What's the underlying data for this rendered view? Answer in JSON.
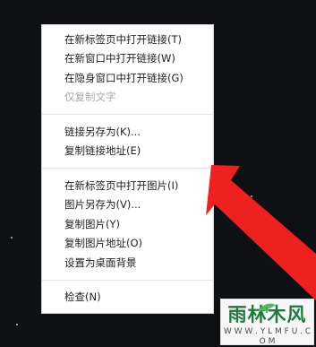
{
  "context_menu": {
    "groups": [
      {
        "items": [
          {
            "label": "在新标签页中打开链接(T)",
            "enabled": true
          },
          {
            "label": "在新窗口中打开链接(W)",
            "enabled": true
          },
          {
            "label": "在隐身窗口中打开链接(G)",
            "enabled": true
          },
          {
            "label": "仅复制文字",
            "enabled": false
          }
        ]
      },
      {
        "items": [
          {
            "label": "链接另存为(K)...",
            "enabled": true
          },
          {
            "label": "复制链接地址(E)",
            "enabled": true
          }
        ]
      },
      {
        "items": [
          {
            "label": "在新标签页中打开图片(I)",
            "enabled": true
          },
          {
            "label": "图片另存为(V)...",
            "enabled": true
          },
          {
            "label": "复制图片(Y)",
            "enabled": true
          },
          {
            "label": "复制图片地址(O)",
            "enabled": true
          },
          {
            "label": "设置为桌面背景",
            "enabled": true
          }
        ]
      },
      {
        "items": [
          {
            "label": "检查(N)",
            "enabled": true
          }
        ]
      }
    ]
  },
  "watermark": {
    "title": "雨林木风",
    "url": "W W W . Y L M F U . C O M"
  },
  "colors": {
    "background": "#0f1013",
    "menu_background": "#ffffff",
    "text": "#222222",
    "disabled_text": "#aaaaaa",
    "arrow": "#ee2020",
    "watermark_green": "#1e7a3a"
  },
  "icons": {
    "arrow": "red-arrow-icon",
    "watermark_leaf": "leaf-icon"
  }
}
